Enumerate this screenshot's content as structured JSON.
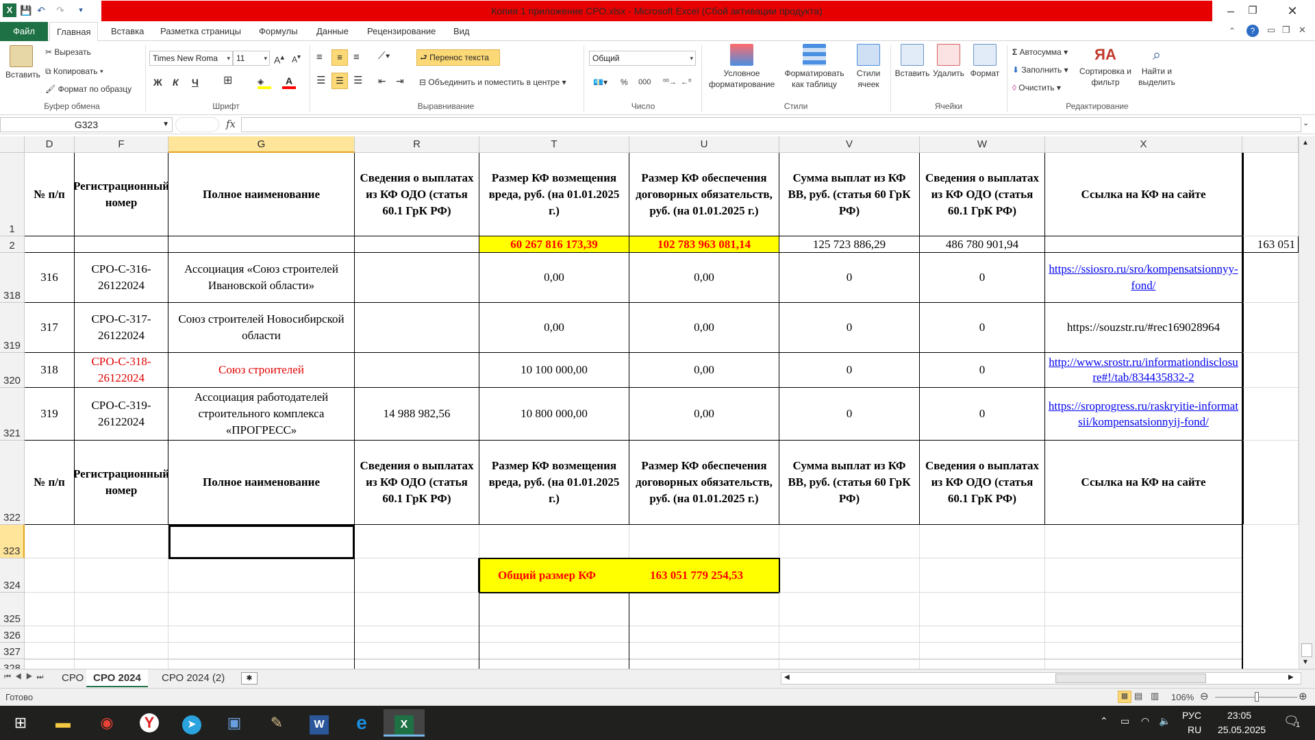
{
  "window": {
    "title": "Копия 1 приложение СРО.xlsx  -  Microsoft Excel (Сбой активации продукта)"
  },
  "colors": {
    "excel_green": "#1e7145",
    "title_red": "#e60000",
    "highlight_yellow": "#ffff00",
    "selection_header": "#ffe59a",
    "link_blue": "#0000ee"
  },
  "tabs": {
    "file": "Файл",
    "items": [
      "Главная",
      "Вставка",
      "Разметка страницы",
      "Формулы",
      "Данные",
      "Рецензирование",
      "Вид"
    ]
  },
  "ribbon": {
    "clipboard": {
      "paste": "Вставить",
      "cut": "Вырезать",
      "copy": "Копировать",
      "format_painter": "Формат по образцу",
      "label": "Буфер обмена"
    },
    "font": {
      "name": "Times New Roma",
      "size": "11",
      "bold": "Ж",
      "italic": "К",
      "underline": "Ч",
      "label": "Шрифт"
    },
    "alignment": {
      "wrap": "Перенос текста",
      "merge": "Объединить и поместить в центре",
      "label": "Выравнивание"
    },
    "number": {
      "format": "Общий",
      "label": "Число"
    },
    "styles": {
      "conditional": "Условное форматирование",
      "as_table": "Форматировать как таблицу",
      "cell_styles": "Стили ячеек",
      "label": "Стили"
    },
    "cells": {
      "insert": "Вставить",
      "delete": "Удалить",
      "format": "Формат",
      "label": "Ячейки"
    },
    "editing": {
      "autosum": "Автосумма",
      "fill": "Заполнить",
      "clear": "Очистить",
      "sort": "Сортировка и фильтр",
      "find": "Найти и выделить",
      "label": "Редактирование"
    }
  },
  "formula_bar": {
    "name_box": "G323",
    "fx": "fx",
    "formula": ""
  },
  "grid": {
    "columns": [
      "D",
      "F",
      "G",
      "R",
      "T",
      "U",
      "V",
      "W",
      "X"
    ],
    "selected_column": "G",
    "selected_row": "323",
    "row_numbers": [
      "1",
      "2",
      "318",
      "319",
      "320",
      "321",
      "322",
      "323",
      "324",
      "325",
      "326",
      "327",
      "328"
    ],
    "header": {
      "num": "№ п/п",
      "reg": "Регистрационный номер",
      "name": "Полное наименование",
      "r": "Сведения о выплатах из КФ ОДО (статья 60.1 ГрК РФ)",
      "t": "Размер КФ возмещения вреда, руб. (на 01.01.2025 г.)",
      "u": "Размер КФ обеспечения договорных обязательств, руб. (на 01.01.2025 г.)",
      "v": "Сумма выплат из КФ ВВ, руб. (статья 60 ГрК РФ)",
      "w": "Сведения о выплатах из КФ ОДО (статья 60.1 ГрК РФ)",
      "x": "Ссылка на КФ на сайте"
    },
    "totals_row": {
      "t": "60 267 816 173,39",
      "u": "102 783 963 081,14",
      "v": "125 723 886,29",
      "w": "486 780 901,94",
      "overflow": "163 051"
    },
    "rows": [
      {
        "num": "316",
        "reg": "СРО-С-316-26122024",
        "name": "Ассоциация «Союз строителей Ивановской области»",
        "r": "",
        "t": "0,00",
        "u": "0,00",
        "v": "0",
        "w": "0",
        "x": "https://ssiosro.ru/sro/kompensatsionnyy-fond/"
      },
      {
        "num": "317",
        "reg": "СРО-С-317-26122024",
        "name": "Союз строителей Новосибирской области",
        "r": "",
        "t": "0,00",
        "u": "0,00",
        "v": "0",
        "w": "0",
        "x": "https://souzstr.ru/#rec169028964"
      },
      {
        "num": "318",
        "reg": "СРО-С-318-26122024",
        "name": "Союз строителей",
        "r": "",
        "t": "10 100 000,00",
        "u": "0,00",
        "v": "0",
        "w": "0",
        "x": "http://www.srostr.ru/informationdisclosure#!/tab/834435832-2"
      },
      {
        "num": "319",
        "reg": "СРО-С-319-26122024",
        "name": "Ассоциация работодателей строительного комплекса «ПРОГРЕСС»",
        "r": "14 988 982,56",
        "t": "10 800 000,00",
        "u": "0,00",
        "v": "0",
        "w": "0",
        "x": "https://sroprogress.ru/raskryitie-informatsii/kompensatsionnyij-fond/"
      }
    ],
    "total_box": {
      "label": "Общий размер  КФ",
      "value": "163 051 779 254,53"
    }
  },
  "sheets": {
    "tabs": [
      "СРО",
      "СРО 2024",
      "СРО 2024  (2)"
    ],
    "active": "СРО 2024"
  },
  "status": {
    "ready": "Готово",
    "zoom": "106%"
  },
  "taskbar": {
    "lang1": "РУС",
    "lang2": "RU",
    "time": "23:05",
    "date": "25.05.2025",
    "notifications": "1"
  }
}
